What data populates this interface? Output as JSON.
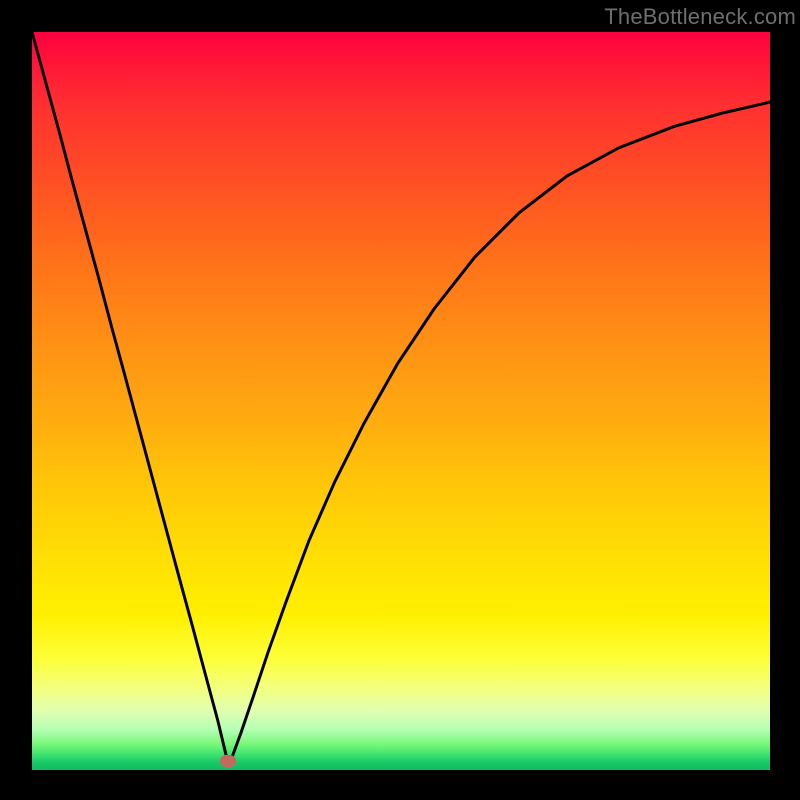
{
  "watermark": "TheBottleneck.com",
  "chart_data": {
    "type": "line",
    "title": "",
    "xlabel": "",
    "ylabel": "",
    "x_range": [
      0,
      1
    ],
    "y_range": [
      0,
      1
    ],
    "marker": {
      "x": 0.265,
      "y": 0.012
    },
    "series": [
      {
        "name": "curve",
        "points": [
          {
            "x": 0.0,
            "y": 1.0
          },
          {
            "x": 0.018,
            "y": 0.934
          },
          {
            "x": 0.036,
            "y": 0.868
          },
          {
            "x": 0.054,
            "y": 0.8
          },
          {
            "x": 0.072,
            "y": 0.734
          },
          {
            "x": 0.09,
            "y": 0.668
          },
          {
            "x": 0.108,
            "y": 0.6
          },
          {
            "x": 0.126,
            "y": 0.534
          },
          {
            "x": 0.144,
            "y": 0.467
          },
          {
            "x": 0.162,
            "y": 0.4
          },
          {
            "x": 0.18,
            "y": 0.333
          },
          {
            "x": 0.198,
            "y": 0.266
          },
          {
            "x": 0.216,
            "y": 0.2
          },
          {
            "x": 0.234,
            "y": 0.133
          },
          {
            "x": 0.252,
            "y": 0.066
          },
          {
            "x": 0.263,
            "y": 0.02
          },
          {
            "x": 0.267,
            "y": 0.01
          },
          {
            "x": 0.272,
            "y": 0.02
          },
          {
            "x": 0.283,
            "y": 0.05
          },
          {
            "x": 0.3,
            "y": 0.1
          },
          {
            "x": 0.32,
            "y": 0.16
          },
          {
            "x": 0.345,
            "y": 0.23
          },
          {
            "x": 0.375,
            "y": 0.31
          },
          {
            "x": 0.41,
            "y": 0.39
          },
          {
            "x": 0.45,
            "y": 0.47
          },
          {
            "x": 0.495,
            "y": 0.55
          },
          {
            "x": 0.545,
            "y": 0.625
          },
          {
            "x": 0.6,
            "y": 0.695
          },
          {
            "x": 0.66,
            "y": 0.755
          },
          {
            "x": 0.725,
            "y": 0.805
          },
          {
            "x": 0.795,
            "y": 0.843
          },
          {
            "x": 0.87,
            "y": 0.872
          },
          {
            "x": 0.935,
            "y": 0.89
          },
          {
            "x": 1.0,
            "y": 0.905
          }
        ]
      }
    ],
    "background_gradient": {
      "direction": "vertical",
      "stops": [
        {
          "pos": 0.0,
          "color": "#ff0040"
        },
        {
          "pos": 0.5,
          "color": "#ffaa10"
        },
        {
          "pos": 0.85,
          "color": "#fdff3a"
        },
        {
          "pos": 1.0,
          "color": "#10bc60"
        }
      ]
    }
  }
}
